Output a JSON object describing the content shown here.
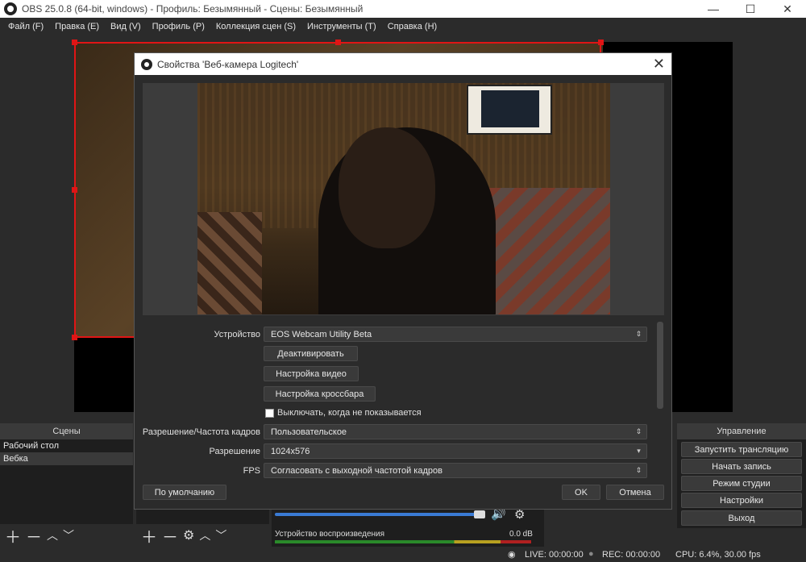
{
  "window": {
    "title": "OBS 25.0.8 (64-bit, windows) - Профиль: Безымянный - Сцены: Безымянный",
    "minimize": "—",
    "maximize": "☐",
    "close": "✕"
  },
  "menu": [
    "Файл (F)",
    "Правка (E)",
    "Вид (V)",
    "Профиль (P)",
    "Коллекция сцен (S)",
    "Инструменты (T)",
    "Справка (H)"
  ],
  "scenes": {
    "title": "Сцены",
    "items": [
      "Рабочий стол",
      "Вебка"
    ],
    "selected_index": 1
  },
  "controls": {
    "title": "Управление",
    "buttons": [
      "Запустить трансляцию",
      "Начать запись",
      "Режим студии",
      "Настройки",
      "Выход"
    ]
  },
  "mixer": {
    "device_label": "Устройство воспроизведения",
    "level": "0.0 dB",
    "volume_fraction": 0.97
  },
  "status": {
    "live": "LIVE: 00:00:00",
    "rec": "REC: 00:00:00",
    "cpu": "CPU: 6.4%, 30.00 fps"
  },
  "dialog": {
    "title": "Свойства 'Веб-камера Logitech'",
    "close": "✕",
    "device_label": "Устройство",
    "device_value": "EOS Webcam Utility Beta",
    "deactivate": "Деактивировать",
    "video_settings": "Настройка видео",
    "crossbar_settings": "Настройка кроссбара",
    "hide_checkbox_label": "Выключать, когда не показывается",
    "res_fps_label": "Разрешение/Частота кадров",
    "res_fps_value": "Пользовательское",
    "resolution_label": "Разрешение",
    "resolution_value": "1024x576",
    "fps_label": "FPS",
    "fps_value": "Согласовать с выходной частотой кадров",
    "defaults": "По умолчанию",
    "ok": "OK",
    "cancel": "Отмена"
  },
  "colors": {
    "selection": "#e01515",
    "accent": "#3a7bd5"
  }
}
